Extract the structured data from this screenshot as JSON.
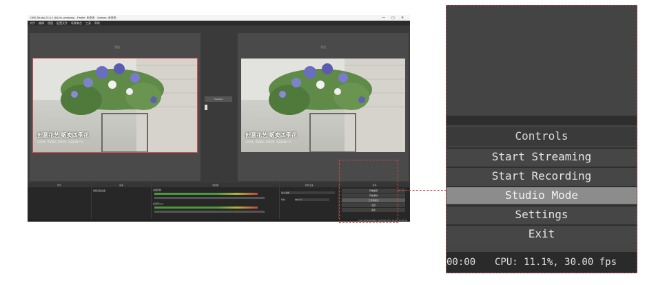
{
  "window": {
    "title": "OBS Studio 23.0.2 (64-bit, windows) - Profile: 未命名 - Scenes: 未命名",
    "buttons": [
      "—",
      "▢",
      "✕"
    ]
  },
  "menu": [
    "文件",
    "编辑",
    "视图",
    "配置文件",
    "场景集合",
    "工具",
    "帮助"
  ],
  "preview": {
    "label": "预览"
  },
  "program": {
    "label": "节目"
  },
  "scene": {
    "caption": "创意花艺 贩卖四季花",
    "subcaption": "以花为媒，传递美好；四季花开，点亮生活每一天。"
  },
  "transition": {
    "label": "Transition"
  },
  "docks": {
    "scenes_header": "场景",
    "sources_header": "来源",
    "sources_item": "视频采集设备",
    "mixer_header": "混音器",
    "mixer_rows": [
      "桌面音频",
      "麦克风/Aux"
    ],
    "transitions_header": "场景过渡",
    "transitions_value": "淡入淡出",
    "duration_label": "时长",
    "duration_value": "300 ms",
    "controls_header": "控件",
    "controls": [
      "开始推流",
      "开始录制",
      "工作室模式",
      "设置",
      "退出"
    ],
    "status": "LIVE: 00:00:00  REC: 00:00:00  CPU: 11.1%, 30.00 fps"
  },
  "zoom": {
    "header": "Controls",
    "buttons": [
      "Start Streaming",
      "Start Recording",
      "Studio Mode",
      "Settings",
      "Exit"
    ],
    "active_index": 2,
    "status_time": "00:00",
    "status_cpu": "CPU: 11.1%, 30.00 fps"
  },
  "colors": {
    "accent_dash": "#c84a4a",
    "active_button": "#8c8c8c"
  },
  "icons": [
    "minimize-icon",
    "maximize-icon",
    "close-icon",
    "flower-arrangement-image"
  ]
}
